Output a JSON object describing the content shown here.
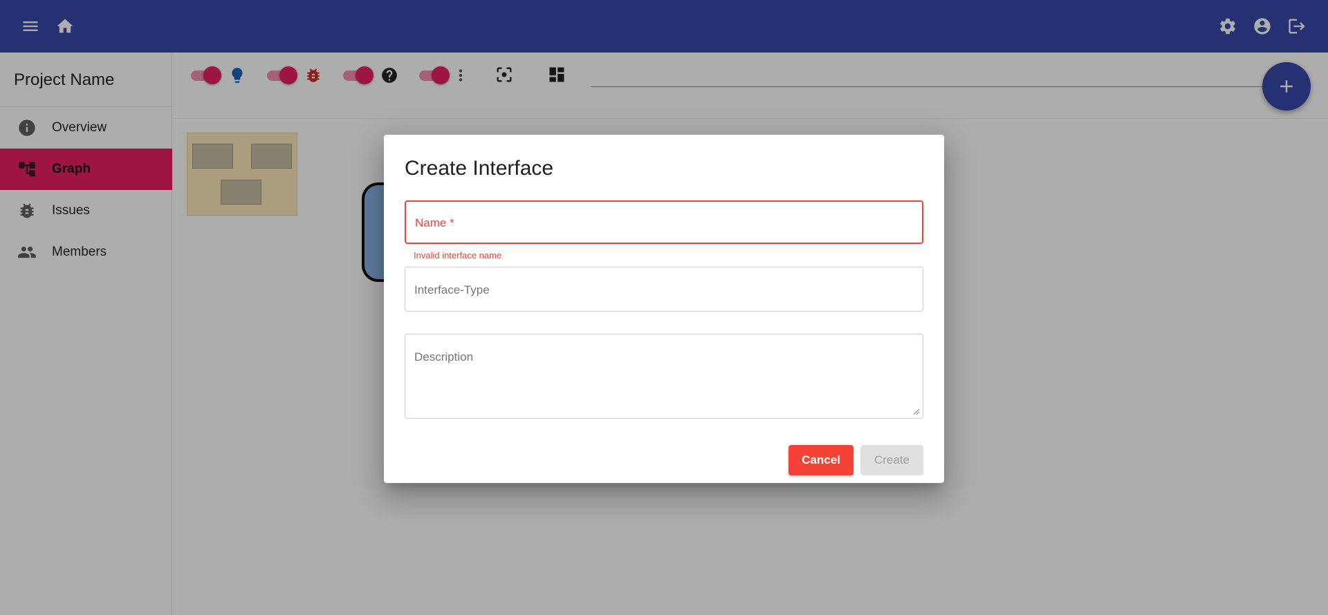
{
  "appbar": {
    "menu_icon": "menu-icon",
    "home_icon": "home-icon",
    "settings_icon": "gear-icon",
    "account_icon": "account-circle-icon",
    "logout_icon": "logout-icon",
    "color": "#3949ab"
  },
  "sidebar": {
    "project_name": "Project Name",
    "items": [
      {
        "label": "Overview",
        "icon": "info-icon",
        "active": false
      },
      {
        "label": "Graph",
        "icon": "graph-icon",
        "active": true
      },
      {
        "label": "Issues",
        "icon": "bug-icon",
        "active": false
      },
      {
        "label": "Members",
        "icon": "people-icon",
        "active": false
      }
    ],
    "active_color": "#e91e63"
  },
  "toolbar": {
    "toggles": [
      {
        "name": "feature-requests",
        "icon": "lightbulb-icon",
        "on": true
      },
      {
        "name": "bugs",
        "icon": "bug-icon",
        "on": true
      },
      {
        "name": "unclassified",
        "icon": "help-icon",
        "on": true
      },
      {
        "name": "links",
        "icon": "more-vert-icon",
        "on": true
      }
    ],
    "center_icon": "center-focus-icon",
    "layout_icon": "dashboard-icon",
    "select_value": ""
  },
  "fab": {
    "icon": "add-icon"
  },
  "dialog": {
    "title": "Create Interface",
    "name_label": "Name *",
    "name_error": "Invalid interface name",
    "type_label": "Interface-Type",
    "description_label": "Description",
    "cancel_label": "Cancel",
    "create_label": "Create",
    "error_color": "#f44336"
  }
}
